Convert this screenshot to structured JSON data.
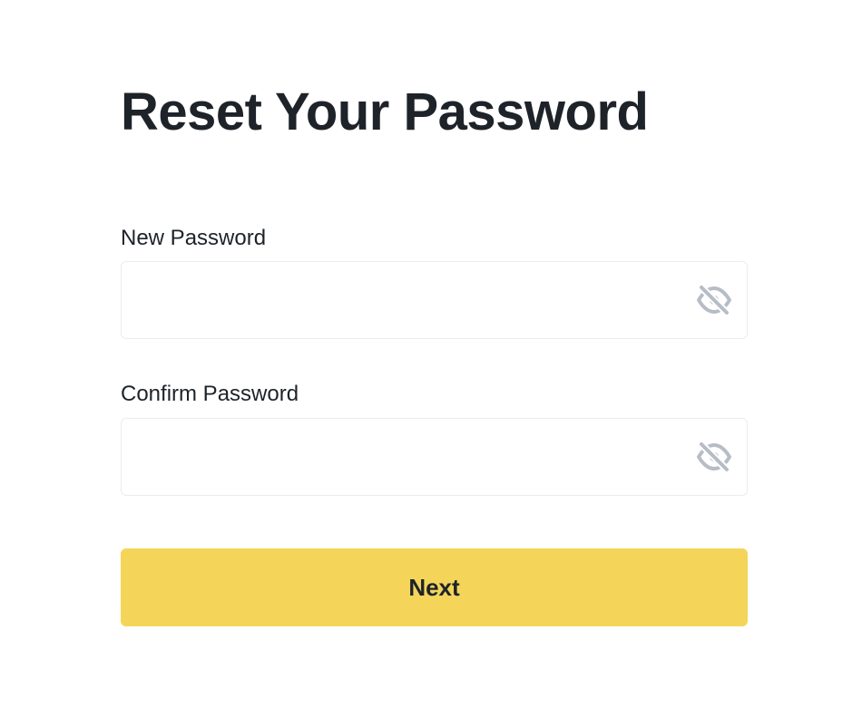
{
  "page": {
    "title": "Reset Your Password"
  },
  "form": {
    "new_password": {
      "label": "New Password",
      "value": "",
      "toggle_icon": "eye-slash-icon"
    },
    "confirm_password": {
      "label": "Confirm Password",
      "value": "",
      "toggle_icon": "eye-slash-icon"
    },
    "submit_label": "Next"
  },
  "colors": {
    "button_background": "#f4d55a",
    "text": "#1e2329",
    "input_border": "#eaecef",
    "icon": "#b7bdc6"
  }
}
